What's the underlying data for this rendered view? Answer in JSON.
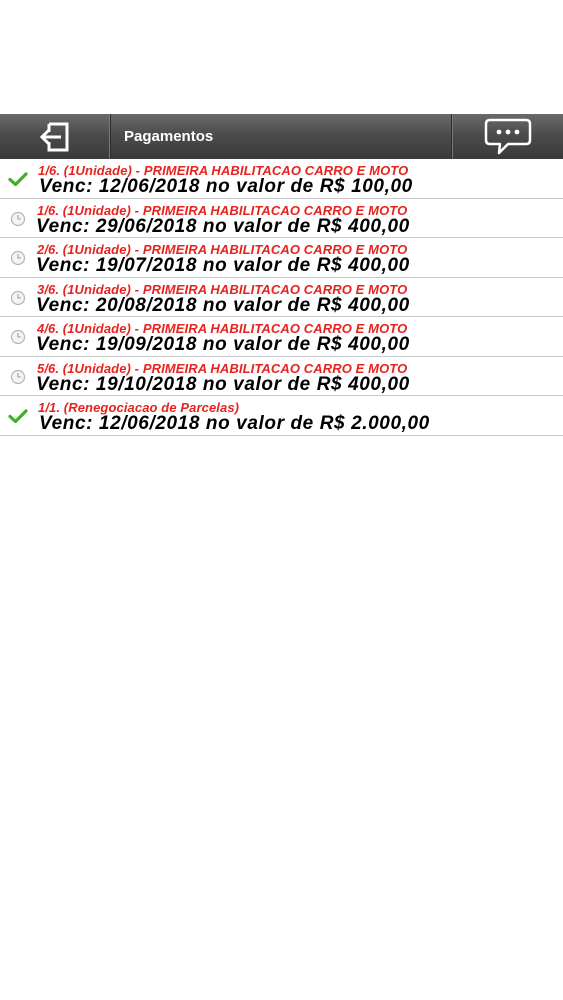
{
  "toolbar": {
    "title": "Pagamentos",
    "back_icon": "logout-arrow-icon",
    "chat_icon": "chat-bubble-icon"
  },
  "colors": {
    "toolbar": "#4c4c4c",
    "installment_label": "#e8231e",
    "due_text": "#000000",
    "paid_check": "#3fae2a",
    "pending_clock": "#b5b5b5",
    "divider": "#c9c9c9"
  },
  "payments": [
    {
      "status": "paid",
      "status_icon": "check-icon",
      "label": "1/6.  (1Unidade) - PRIMEIRA HABILITACAO CARRO E MOTO",
      "due": "Venc: 12/06/2018 no valor de R$ 100,00"
    },
    {
      "status": "pending",
      "status_icon": "clock-icon",
      "label": "1/6.  (1Unidade) - PRIMEIRA HABILITACAO CARRO E MOTO",
      "due": "Venc: 29/06/2018 no valor de R$ 400,00"
    },
    {
      "status": "pending",
      "status_icon": "clock-icon",
      "label": "2/6.  (1Unidade) - PRIMEIRA HABILITACAO CARRO E MOTO",
      "due": "Venc: 19/07/2018 no valor de R$ 400,00"
    },
    {
      "status": "pending",
      "status_icon": "clock-icon",
      "label": "3/6.  (1Unidade) - PRIMEIRA HABILITACAO CARRO E MOTO",
      "due": "Venc: 20/08/2018 no valor de R$ 400,00"
    },
    {
      "status": "pending",
      "status_icon": "clock-icon",
      "label": "4/6.  (1Unidade) - PRIMEIRA HABILITACAO CARRO E MOTO",
      "due": "Venc: 19/09/2018 no valor de R$ 400,00"
    },
    {
      "status": "pending",
      "status_icon": "clock-icon",
      "label": "5/6.  (1Unidade) - PRIMEIRA HABILITACAO CARRO E MOTO",
      "due": "Venc: 19/10/2018 no valor de R$ 400,00"
    },
    {
      "status": "paid",
      "status_icon": "check-icon",
      "label": "1/1.  (Renegociacao de Parcelas)",
      "due": "Venc: 12/06/2018 no valor de R$ 2.000,00"
    }
  ]
}
